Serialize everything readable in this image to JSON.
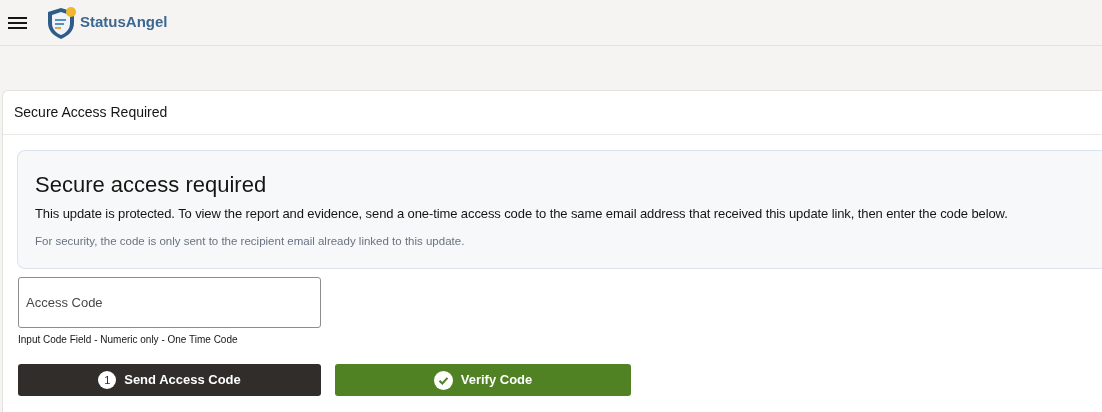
{
  "header": {
    "logo_text": "StatusAngel"
  },
  "card": {
    "title": "Secure Access Required",
    "notice": {
      "heading": "Secure access required",
      "body": "This update is protected. To view the report and evidence, send a one-time access code to the same email address that received this update link, then enter the code below.",
      "note": "For security, the code is only sent to the recipient email already linked to this update."
    },
    "access_code_field": {
      "placeholder": "Access Code",
      "helper": "Input Code Field - Numeric only - One Time Code"
    },
    "buttons": [
      {
        "kind": "step",
        "step": "1",
        "label": "Send Access Code"
      },
      {
        "kind": "check",
        "label": "Verify Code"
      }
    ]
  }
}
